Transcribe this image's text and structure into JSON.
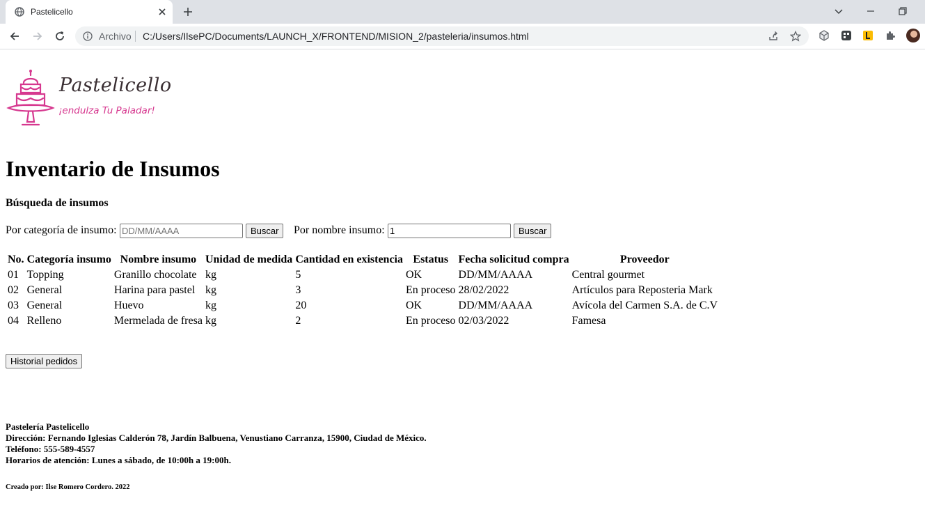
{
  "browser": {
    "tab_title": "Pastelicello",
    "url_scheme": "Archivo",
    "url": "C:/Users/IlsePC/Documents/LAUNCH_X/FRONTEND/MISION_2/pasteleria/insumos.html"
  },
  "logo": {
    "name": "Pastelicello",
    "tagline": "¡endulza Tu Paladar!",
    "color": "#d6388f"
  },
  "page": {
    "title": "Inventario de Insumos",
    "search_heading": "Búsqueda de insumos",
    "category_label": "Por categoría de insumo:",
    "category_placeholder": "DD/MM/AAAA",
    "category_button": "Buscar",
    "name_label": "Por nombre insumo:",
    "name_value": "1",
    "name_button": "Buscar",
    "history_button": "Historial pedidos"
  },
  "table": {
    "headers": [
      "No.",
      "Categoría insumo",
      "Nombre insumo",
      "Unidad de medida",
      "Cantidad en existencia",
      "Estatus",
      "Fecha solicitud compra",
      "Proveedor"
    ],
    "rows": [
      [
        "01",
        "Topping",
        "Granillo chocolate",
        "kg",
        "5",
        "OK",
        "DD/MM/AAAA",
        "Central gourmet"
      ],
      [
        "02",
        "General",
        "Harina para pastel",
        "kg",
        "3",
        "En proceso",
        "28/02/2022",
        "Artículos para Reposteria Mark"
      ],
      [
        "03",
        "General",
        "Huevo",
        "kg",
        "20",
        "OK",
        "DD/MM/AAAA",
        "Avícola del Carmen S.A. de C.V"
      ],
      [
        "04",
        "Relleno",
        "Mermelada de fresa",
        "kg",
        "2",
        "En proceso",
        "02/03/2022",
        "Famesa"
      ]
    ]
  },
  "footer": {
    "business": "Pastelería Pastelicello",
    "address": "Dirección: Fernando Iglesias Calderón 78, Jardín Balbuena, Venustiano Carranza, 15900, Ciudad de México.",
    "phone": "Teléfono: 555-589-4557",
    "hours": "Horarios de atención: Lunes a sábado, de 10:00h a 19:00h.",
    "credits": "Creado por: Ilse Romero Cordero. 2022"
  }
}
